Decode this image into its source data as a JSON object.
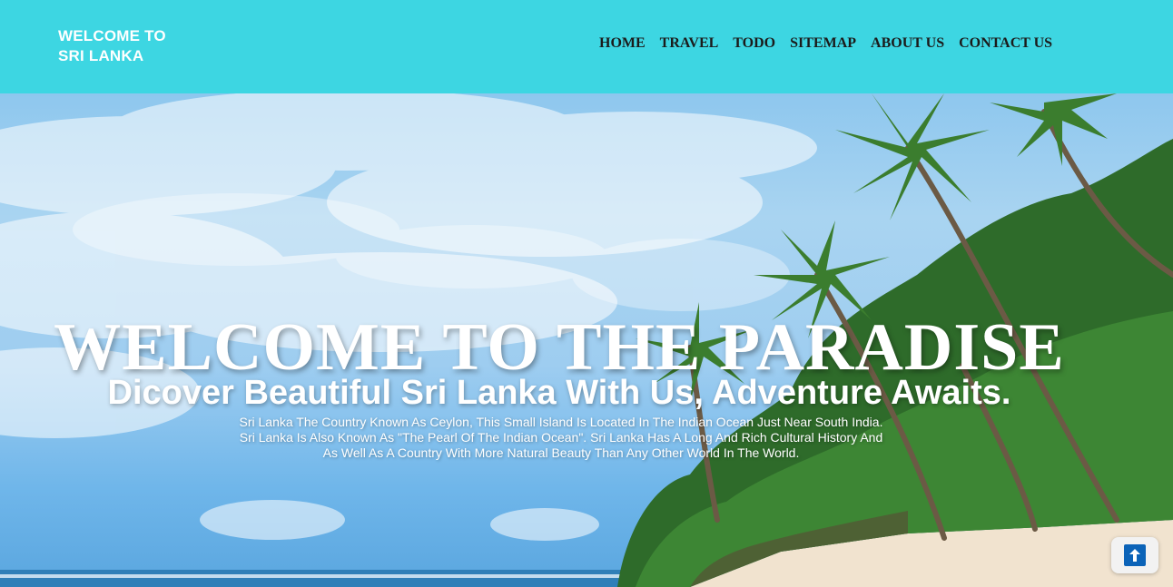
{
  "header": {
    "logo_line1": "WELCOME TO",
    "logo_line2": "SRI LANKA",
    "background_color": "#3dd6e2"
  },
  "nav": {
    "items": [
      {
        "label": "HOME"
      },
      {
        "label": "TRAVEL"
      },
      {
        "label": "TODO"
      },
      {
        "label": "SITEMAP"
      },
      {
        "label": "ABOUT US"
      },
      {
        "label": "CONTACT US"
      }
    ]
  },
  "hero": {
    "title": "WELCOME TO THE PARADISE",
    "subtitle": "Dicover Beautiful Sri Lanka With Us, Adventure Awaits.",
    "description_lines": [
      "Sri Lanka The Country Known As Ceylon, This Small Island Is Located In The Indian Ocean Just Near South India.",
      "Sri Lanka Is Also Known As \"The Pearl Of The Indian Ocean\". Sri Lanka Has A Long And Rich Cultural History And",
      "As Well As A Country With More Natural Beauty Than Any Other World In The World."
    ]
  },
  "scroll_top": {
    "icon": "arrow-up-icon",
    "color": "#0b63b8"
  }
}
